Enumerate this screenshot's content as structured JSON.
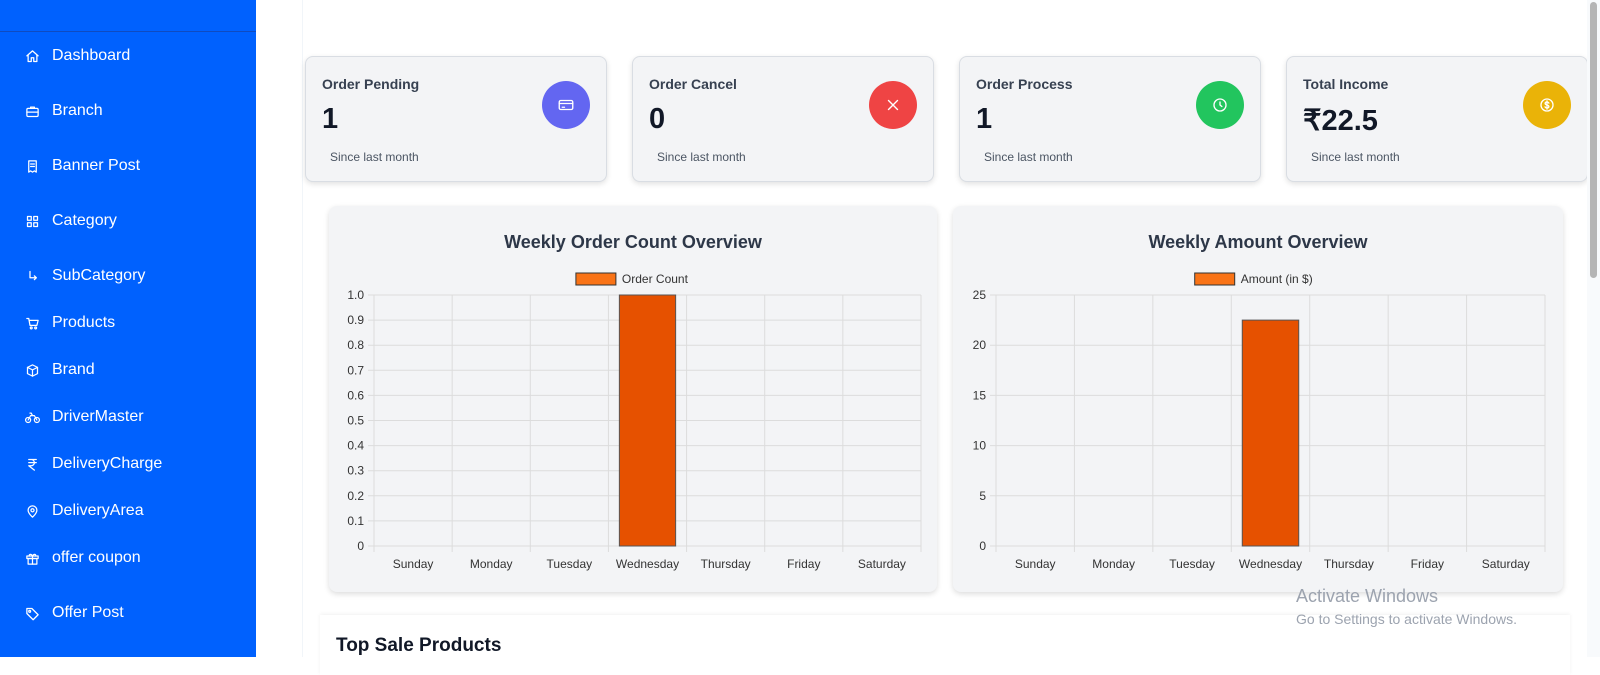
{
  "sidebar": {
    "items": [
      {
        "label": "Dashboard",
        "icon": "home-icon"
      },
      {
        "label": "Branch",
        "icon": "briefcase-icon"
      },
      {
        "label": "Banner Post",
        "icon": "receipt-icon"
      },
      {
        "label": "Category",
        "icon": "grid-icon"
      },
      {
        "label": "SubCategory",
        "icon": "corner-arrow-icon"
      },
      {
        "label": "Products",
        "icon": "cart-icon"
      },
      {
        "label": "Brand",
        "icon": "box-icon"
      },
      {
        "label": "DriverMaster",
        "icon": "bike-icon"
      },
      {
        "label": "DeliveryCharge",
        "icon": "rupee-icon"
      },
      {
        "label": "DeliveryArea",
        "icon": "map-pin-icon"
      },
      {
        "label": "offer coupon",
        "icon": "gift-icon"
      },
      {
        "label": "Offer Post",
        "icon": "tag-icon"
      }
    ]
  },
  "stats": {
    "cards": [
      {
        "title": "Order Pending",
        "value": "1",
        "sub": "Since last month",
        "color": "#6366f1",
        "icon": "credit-card-icon"
      },
      {
        "title": "Order Cancel",
        "value": "0",
        "sub": "Since last month",
        "color": "#ef4444",
        "icon": "close-icon"
      },
      {
        "title": "Order Process",
        "value": "1",
        "sub": "Since last month",
        "color": "#22c55e",
        "icon": "clock-icon"
      },
      {
        "title": "Total Income",
        "value": "₹22.5",
        "sub": "Since last month",
        "color": "#eab308",
        "icon": "dollar-icon"
      }
    ]
  },
  "chart_data": [
    {
      "type": "bar",
      "title": "Weekly Order Count Overview",
      "categories": [
        "Sunday",
        "Monday",
        "Tuesday",
        "Wednesday",
        "Thursday",
        "Friday",
        "Saturday"
      ],
      "series": [
        {
          "name": "Order Count",
          "values": [
            0,
            0,
            0,
            1,
            0,
            0,
            0
          ]
        }
      ],
      "ylim": [
        0,
        1
      ],
      "yticks": [
        "0",
        "0.1",
        "0.2",
        "0.3",
        "0.4",
        "0.5",
        "0.6",
        "0.7",
        "0.8",
        "0.9",
        "1.0"
      ],
      "legend": "top",
      "grid": true,
      "bar_color": "#e65100",
      "legend_color": "#f97316"
    },
    {
      "type": "bar",
      "title": "Weekly Amount Overview",
      "categories": [
        "Sunday",
        "Monday",
        "Tuesday",
        "Wednesday",
        "Thursday",
        "Friday",
        "Saturday"
      ],
      "series": [
        {
          "name": "Amount (in $)",
          "values": [
            0,
            0,
            0,
            22.5,
            0,
            0,
            0
          ]
        }
      ],
      "ylim": [
        0,
        25
      ],
      "yticks": [
        "0",
        "5",
        "10",
        "15",
        "20",
        "25"
      ],
      "legend": "top",
      "grid": true,
      "bar_color": "#e65100",
      "legend_color": "#f97316"
    }
  ],
  "bottom": {
    "title": "Top Sale Products"
  },
  "watermark": {
    "line1": "Activate Windows",
    "line2": "Go to Settings to activate Windows."
  }
}
